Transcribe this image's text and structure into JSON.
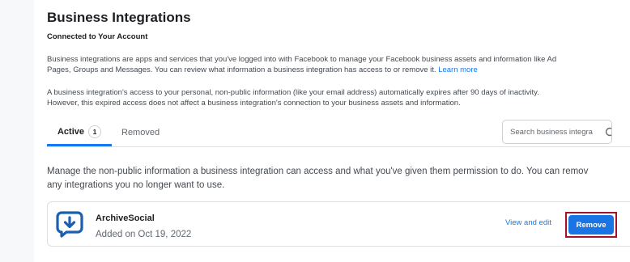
{
  "header": {
    "title": "Business Integrations",
    "subtitle": "Connected to Your Account"
  },
  "intro": {
    "para1_line1": "Business integrations are apps and services that you've logged into with Facebook to manage your Facebook business assets and information like Ad",
    "para1_line2_prefix": "Pages, Groups and Messages. You can review what information a business integration has access to or remove it.",
    "learn_more": "Learn more",
    "para2_line1": "A business integration's access to your personal, non-public information (like your email address) automatically expires after 90 days of inactivity.",
    "para2_line2": "However, this expired access does not affect a business integration's connection to your business assets and information."
  },
  "tabs": {
    "active_label": "Active",
    "active_count": "1",
    "removed_label": "Removed"
  },
  "search": {
    "placeholder": "Search business integra"
  },
  "description": {
    "line1": "Manage the non-public information a business integration can access and what you've given them permission to do. You can remov",
    "line2": "any integrations you no longer want to use."
  },
  "integrations": [
    {
      "name": "ArchiveSocial",
      "added": "Added on Oct 19, 2022",
      "view_edit_label": "View and edit",
      "remove_label": "Remove",
      "logo_icon": "archive-social-logo-icon"
    }
  ],
  "colors": {
    "accent": "#1877f2",
    "remove_button": "#1b74e4",
    "highlight_outline": "#a3122b",
    "logo": "#1b5fb0"
  }
}
